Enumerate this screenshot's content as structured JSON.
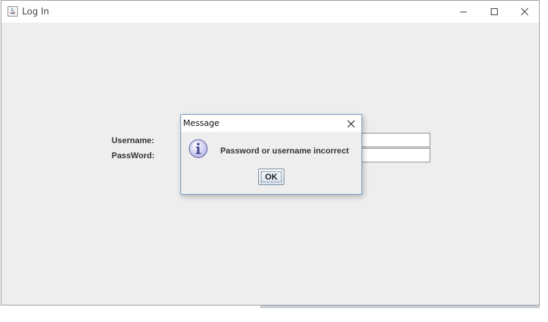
{
  "window": {
    "title": "Log In",
    "controls": {
      "minimize": "minimize",
      "maximize": "maximize",
      "close": "close"
    }
  },
  "form": {
    "username_label": "Username:",
    "password_label": "PassWord:",
    "username_value": "",
    "password_value": ""
  },
  "dialog": {
    "title": "Message",
    "message": "Password or username incorrect",
    "ok_label": "OK",
    "icon": "info-icon"
  }
}
